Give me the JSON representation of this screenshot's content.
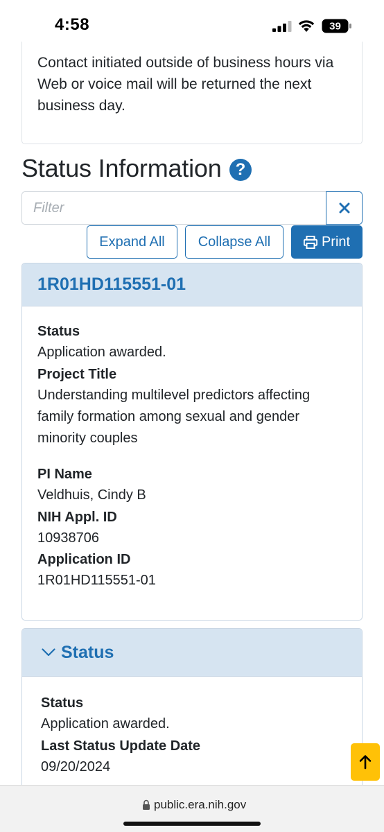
{
  "status_bar": {
    "time": "4:58",
    "battery": "39"
  },
  "contact_info": {
    "text": "Contact initiated outside of business hours via Web or voice mail will be returned the next business day."
  },
  "status_section": {
    "title": "Status Information",
    "help_icon": "?",
    "filter_placeholder": "Filter",
    "clear_icon": "close-icon",
    "buttons": {
      "expand": "Expand All",
      "collapse": "Collapse All",
      "print": "Print"
    }
  },
  "grant_card": {
    "header": "1R01HD115551-01",
    "fields": [
      {
        "label": "Status",
        "value": "Application awarded."
      },
      {
        "label": "Project Title",
        "value": "Understanding multilevel predictors affecting family formation among sexual and gender minority couples"
      },
      {
        "label": "PI Name",
        "value": "Veldhuis, Cindy B"
      },
      {
        "label": "NIH Appl. ID",
        "value": "10938706"
      },
      {
        "label": "Application ID",
        "value": "1R01HD115551-01"
      }
    ]
  },
  "status_card": {
    "header": "Status",
    "fields": [
      {
        "label": "Status",
        "value": "Application awarded."
      },
      {
        "label": "Last Status Update Date",
        "value": "09/20/2024"
      }
    ]
  },
  "url_bar": {
    "url": "public.era.nih.gov"
  },
  "colors": {
    "primary": "#1f6fb2",
    "card_header_bg": "#d6e4f1",
    "back_to_top": "#ffc107"
  }
}
